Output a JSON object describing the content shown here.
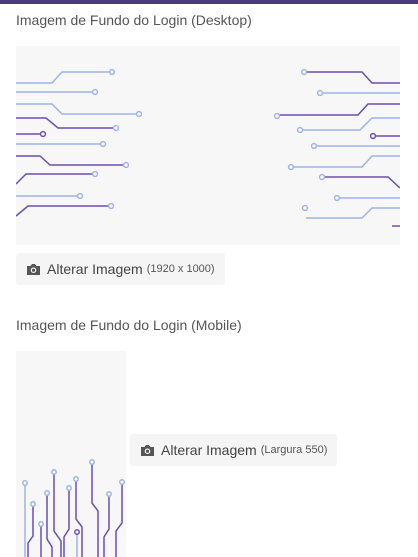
{
  "theme": {
    "accent": "#4a3c7c",
    "line_purple": "#6b4fb0",
    "line_blue": "#9fb3e8",
    "preview_bg": "#f7f7f8"
  },
  "desktop": {
    "title": "Imagem de Fundo do Login (Desktop)",
    "button_label": "Alterar Imagem",
    "button_note": "(1920 x 1000)",
    "icon": "camera-icon"
  },
  "mobile": {
    "title": "Imagem de Fundo do Login (Mobile)",
    "button_label": "Alterar Imagem",
    "button_note": "(Largura 550)",
    "icon": "camera-icon"
  }
}
